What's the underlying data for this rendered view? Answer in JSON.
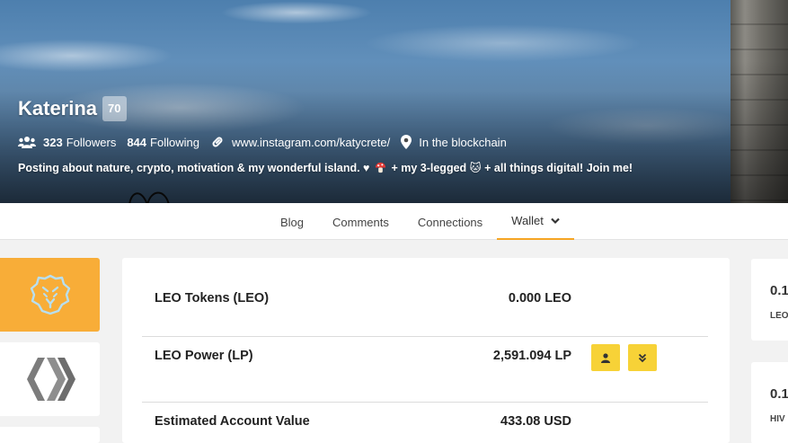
{
  "profile": {
    "name": "Katerina",
    "reputation": "70",
    "followers_count": "323",
    "followers_label": "Followers",
    "following_count": "844",
    "following_label": "Following",
    "website": "www.instagram.com/katycrete/",
    "location": "In the blockchain",
    "bio_part1": "Posting about nature, crypto, motivation & my wonderful island. ♥",
    "bio_part2": "+ my 3-legged 🐱 + all things digital! Join me!"
  },
  "tabs": [
    {
      "label": "Blog"
    },
    {
      "label": "Comments"
    },
    {
      "label": "Connections"
    },
    {
      "label": "Wallet"
    }
  ],
  "active_tab": "Wallet",
  "wallet": {
    "rows": [
      {
        "label": "LEO Tokens (LEO)",
        "value": "0.000 LEO"
      },
      {
        "label": "LEO Power (LP)",
        "value": "2,591.094 LP"
      },
      {
        "label": "Estimated Account Value",
        "value": "433.08 USD"
      }
    ],
    "actions": [
      {
        "icon": "user-icon"
      },
      {
        "icon": "double-chevron-down-icon"
      }
    ]
  },
  "token_cards": [
    {
      "icon": "leo-lion-icon",
      "color": "#f8ad38"
    },
    {
      "icon": "hive-logo-icon",
      "color": "#ffffff"
    }
  ],
  "side_cards": [
    {
      "amount": "0.1",
      "symbol": "LEO"
    },
    {
      "amount": "0.1",
      "symbol": "HIV"
    }
  ],
  "colors": {
    "accent": "#f6a524",
    "leo_orange": "#f8ad38",
    "button_yellow": "#f7d237"
  }
}
